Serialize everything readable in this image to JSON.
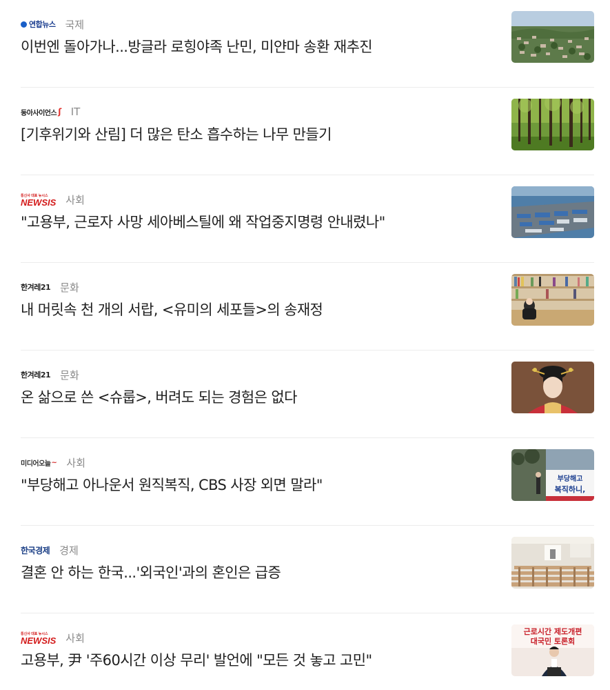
{
  "articles": [
    {
      "publisher": "연합뉴스",
      "category": "국제",
      "headline": "이번엔 돌아가나...방글라 로힝야족 난민, 미얀마 송환 재추진",
      "thumb_icon": "hillside-village-photo"
    },
    {
      "publisher": "동아사이언스",
      "category": "IT",
      "headline": "[기후위기와 산림] 더 많은 탄소 흡수하는 나무 만들기",
      "thumb_icon": "forest-photo"
    },
    {
      "publisher": "NEWSIS",
      "publisher_small": "통신사 대표 뉴시스",
      "category": "사회",
      "headline": "\"고용부, 근로자 사망 세아베스틸에 왜 작업중지명령 안내렸나\"",
      "thumb_icon": "industrial-port-photo"
    },
    {
      "publisher": "한겨레21",
      "category": "문화",
      "headline": "내 머릿속 천 개의 서랍, <유미의 세포들>의 송재정",
      "thumb_icon": "bookshelf-interview-photo"
    },
    {
      "publisher": "한겨레21",
      "category": "문화",
      "headline": "온 삶으로 쓴 <슈룹>, 버려도 되는 경험은 없다",
      "thumb_icon": "drama-actress-photo"
    },
    {
      "publisher": "미디어오늘",
      "category": "사회",
      "headline": "\"부당해고 아나운서 원직복직, CBS 사장 외면 말라\"",
      "thumb_icon": "protest-sign-photo",
      "thumb_text": [
        "부당해고",
        "복직하니,"
      ]
    },
    {
      "publisher": "한국경제",
      "category": "경제",
      "headline": "결혼 안 하는 한국...'외국인'과의 혼인은 급증",
      "thumb_icon": "wedding-hall-photo"
    },
    {
      "publisher": "NEWSIS",
      "publisher_small": "통신사 대표 뉴시스",
      "category": "사회",
      "headline": "고용부, 尹 '주60시간 이상 무리' 발언에 \"모든 것 놓고 고민\"",
      "thumb_icon": "press-conference-photo",
      "thumb_text": [
        "근로시간 제도개편",
        "대국민 토론회"
      ]
    }
  ],
  "colors": {
    "headline": "#1f1f1f",
    "category": "#8a8a8a",
    "divider": "#ececec",
    "newsis_red": "#d31a1a",
    "yonhap_blue": "#1a3d8f"
  }
}
